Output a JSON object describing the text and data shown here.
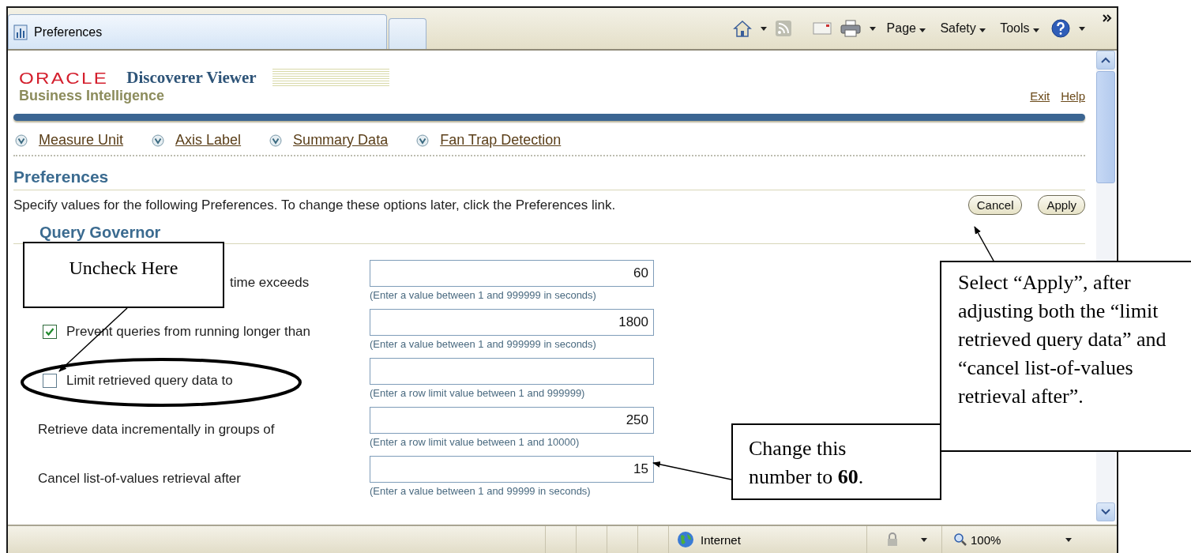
{
  "browser": {
    "tab_title": "Preferences",
    "menus": [
      "Page",
      "Safety",
      "Tools"
    ]
  },
  "header": {
    "brand": "ORACLE",
    "product": "Discoverer Viewer",
    "subtitle": "Business Intelligence",
    "links": [
      "Exit",
      "Help"
    ]
  },
  "nav_links": [
    "Measure Unit",
    "Axis Label",
    "Summary Data",
    "Fan Trap Detection"
  ],
  "page": {
    "title": "Preferences",
    "description": "Specify values for the following Preferences. To change these options later, click the Preferences link.",
    "buttons": [
      "Cancel",
      "Apply"
    ],
    "section_title": "Query Governor",
    "settings": [
      {
        "kind": "text",
        "label": "time exceeds",
        "value": "60",
        "hint": "(Enter a value between 1 and 999999 in seconds)"
      },
      {
        "kind": "checkbox",
        "checked": true,
        "label": "Prevent queries from running longer than",
        "value": "1800",
        "hint": "(Enter a value between 1 and 999999 in seconds)"
      },
      {
        "kind": "checkbox",
        "checked": false,
        "label": "Limit retrieved query data to",
        "hint": "(Enter a row limit value between 1 and 999999)"
      },
      {
        "kind": "text",
        "label": "Retrieve data incrementally in groups of",
        "value": "250",
        "hint": "(Enter a row limit value between 1 and 10000)"
      },
      {
        "kind": "text",
        "label": "Cancel list-of-values retrieval after",
        "value": "15",
        "hint": "(Enter a value between 1 and 99999 in seconds)"
      }
    ]
  },
  "status_bar": {
    "zone": "Internet",
    "zoom": "100%"
  },
  "annotations": [
    "Uncheck Here",
    "Select “Apply”, after adjusting both the “limit retrieved query data” and “cancel list-of-values retrieval after”.",
    "Change this number to **60**."
  ]
}
